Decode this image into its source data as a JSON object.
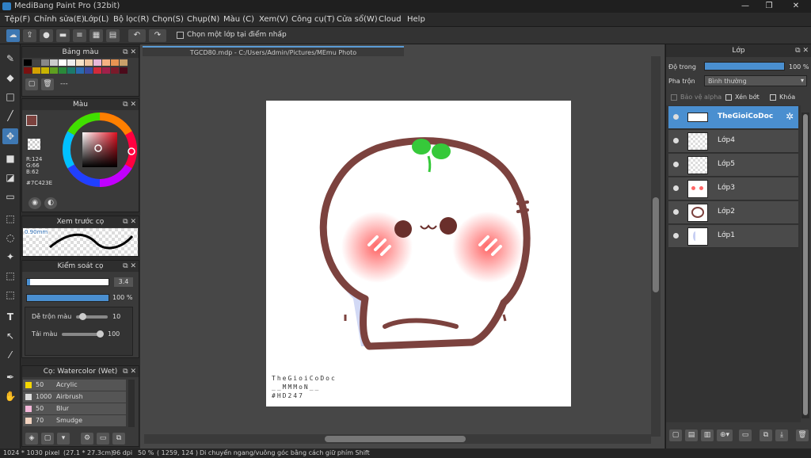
{
  "window": {
    "title": "MediBang Paint Pro (32bit)",
    "minimize": "—",
    "maximize": "❐",
    "close": "✕"
  },
  "menu": [
    "Tệp(F)",
    "Chỉnh sửa(E)",
    "Lớp(L)",
    "Bộ lọc(R)",
    "Chọn(S)",
    "Chụp(N)",
    "Màu (C)",
    "Xem(V)",
    "Công cụ(T)",
    "Cửa sổ(W)",
    "Cloud",
    "Help"
  ],
  "toolbar": {
    "undo": "↶",
    "redo": "↷",
    "select_layer_on_click": "Chọn một lớp tại điểm nhấp"
  },
  "palette_panel": {
    "title": "Bảng màu",
    "palette_name": "---"
  },
  "color_panel": {
    "title": "Màu",
    "r": "R:124",
    "g": "G:66",
    "b": "B:62",
    "hex": "#7C423E",
    "current_color": "#7c423e"
  },
  "brush_preview": {
    "title": "Xem trước cọ",
    "size": "0.90mm"
  },
  "brush_control": {
    "title": "Kiểm soát cọ",
    "size_value": "3.4",
    "opacity_value": "100 %",
    "blend_label": "Dễ trộn màu",
    "blend_value": "10",
    "reload_label": "Tải màu",
    "reload_value": "100"
  },
  "brush_list": {
    "title": "Cọ: Watercolor (Wet)",
    "items": [
      {
        "size": "50",
        "name": "Acrylic",
        "color": "#f5d700"
      },
      {
        "size": "1000",
        "name": "Airbrush",
        "color": "#dddddd"
      },
      {
        "size": "50",
        "name": "Blur",
        "color": "#f4b7d9"
      },
      {
        "size": "70",
        "name": "Smudge",
        "color": "#f2d3c0"
      }
    ]
  },
  "document": {
    "tab": "TGCD80.mdp - C:/Users/Admin/Pictures/MEmu Photo",
    "signature": [
      "TheGioiCoDoc",
      "__MMMoN__",
      "#HD247"
    ]
  },
  "layer_panel": {
    "title": "Lớp",
    "opacity_label": "Độ trong",
    "opacity_value": "100 %",
    "blend_label": "Pha trộn",
    "blend_value": "Bình thường",
    "protect_alpha": "Bảo vệ alpha",
    "clipping": "Xén bớt",
    "lock": "Khóa",
    "layers": [
      {
        "name": "TheGioiCoDoc",
        "selected": true
      },
      {
        "name": "Lớp4",
        "selected": false
      },
      {
        "name": "Lớp5",
        "selected": false
      },
      {
        "name": "Lớp3",
        "selected": false
      },
      {
        "name": "Lớp2",
        "selected": false
      },
      {
        "name": "Lớp1",
        "selected": false
      }
    ]
  },
  "status": {
    "size": "1024 * 1030 pixel",
    "physical": "(27.1 * 27.3cm)",
    "dpi": "96 dpi",
    "zoom": "50 %",
    "coords": "( 1259, 124 )",
    "hint": "Di chuyển ngang/vuông góc bằng cách giữ phím Shift"
  }
}
